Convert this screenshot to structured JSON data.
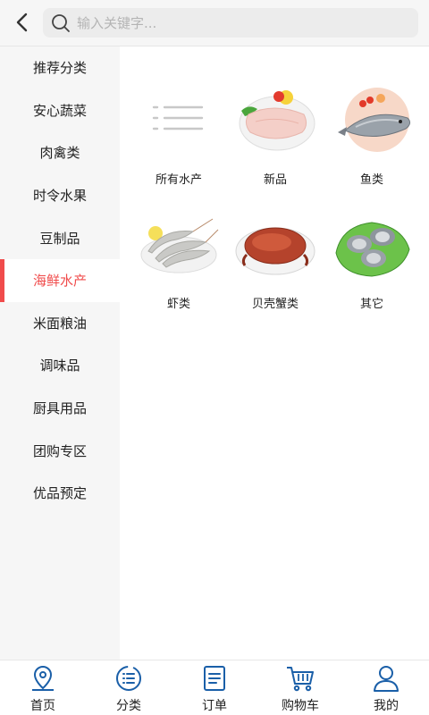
{
  "header": {
    "back_icon": "chevron-left-icon",
    "search": {
      "placeholder": "输入关键字..."
    }
  },
  "sidebar": {
    "active_color": "#f04b4b",
    "items": [
      {
        "label": "推荐分类",
        "active": false
      },
      {
        "label": "安心蔬菜",
        "active": false
      },
      {
        "label": "肉禽类",
        "active": false
      },
      {
        "label": "时令水果",
        "active": false
      },
      {
        "label": "豆制品",
        "active": false
      },
      {
        "label": "海鲜水产",
        "active": true
      },
      {
        "label": "米面粮油",
        "active": false
      },
      {
        "label": "调味品",
        "active": false
      },
      {
        "label": "厨具用品",
        "active": false
      },
      {
        "label": "团购专区",
        "active": false
      },
      {
        "label": "优品预定",
        "active": false
      }
    ]
  },
  "subcategories": [
    {
      "label": "所有水产",
      "icon": "list-icon"
    },
    {
      "label": "新品",
      "icon": "fish-fillet-image"
    },
    {
      "label": "鱼类",
      "icon": "fish-image"
    },
    {
      "label": "虾类",
      "icon": "shrimp-image"
    },
    {
      "label": "贝壳蟹类",
      "icon": "crab-image"
    },
    {
      "label": "其它",
      "icon": "oyster-image"
    }
  ],
  "tabbar": {
    "accent": "#1a5fa8",
    "items": [
      {
        "label": "首页",
        "icon": "location-pin-icon"
      },
      {
        "label": "分类",
        "icon": "category-list-icon"
      },
      {
        "label": "订单",
        "icon": "order-document-icon"
      },
      {
        "label": "购物车",
        "icon": "shopping-cart-icon"
      },
      {
        "label": "我的",
        "icon": "user-icon"
      }
    ]
  }
}
